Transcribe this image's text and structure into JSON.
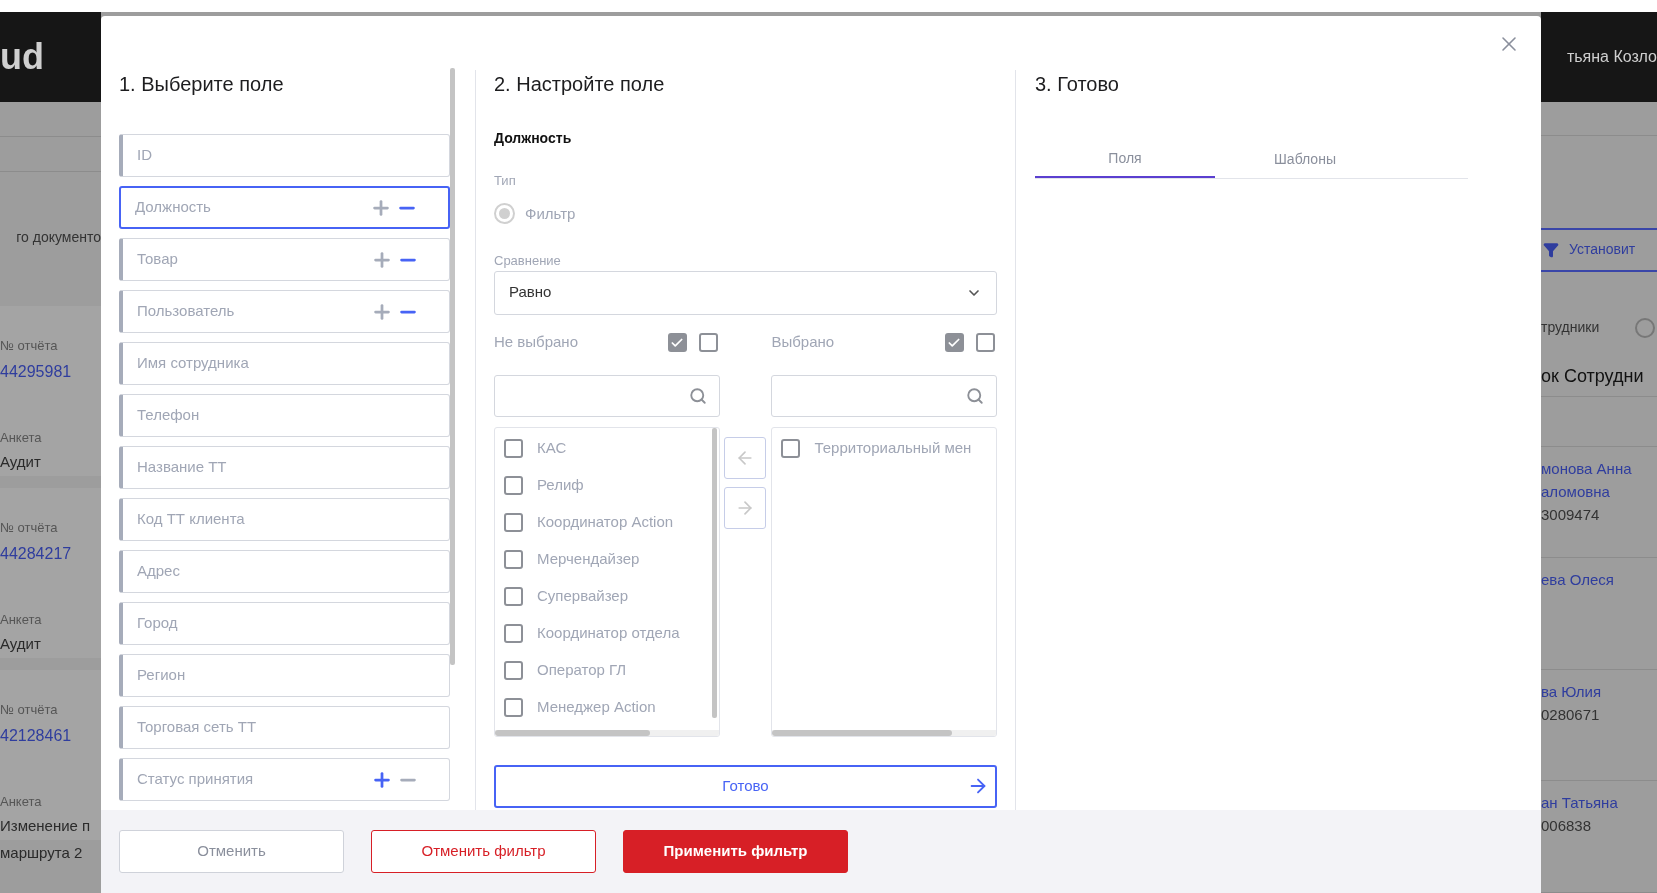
{
  "background": {
    "logo": "ud",
    "user_name": "тьяна Козло",
    "document_label": "го документо",
    "reports": [
      {
        "number_label": "№ отчёта",
        "number": "44295981",
        "form_label": "Анкета",
        "form_lines": [
          "Аудит"
        ]
      },
      {
        "number_label": "№ отчёта",
        "number": "44284217",
        "form_label": "Анкета",
        "form_lines": [
          "Аудит"
        ]
      },
      {
        "number_label": "№ отчёта",
        "number": "42128461",
        "form_label": "Анкета",
        "form_lines": [
          "Изменение п",
          "маршрута 2"
        ]
      }
    ],
    "filter_button": "Установит",
    "employees_label": "трудники",
    "list_title": "ок Сотрудни",
    "employees": [
      {
        "name_lines": [
          "монова Анна",
          "аломовна"
        ],
        "id": "3009474"
      },
      {
        "name_lines": [
          "ева Олеся"
        ]
      },
      {
        "name_lines": [
          "ва Юлия"
        ],
        "id": "0280671"
      },
      {
        "name_lines": [
          "ан Татьяна"
        ],
        "id": "006838"
      }
    ]
  },
  "dialog": {
    "step1": {
      "title": "1. Выберите поле",
      "fields": [
        {
          "label": "ID",
          "kind": "plain",
          "selected": false
        },
        {
          "label": "Должность",
          "kind": "toggle",
          "selected": true,
          "plus_active": false,
          "minus_active": true
        },
        {
          "label": "Товар",
          "kind": "toggle",
          "selected": false,
          "plus_active": false,
          "minus_active": true
        },
        {
          "label": "Пользователь",
          "kind": "toggle",
          "selected": false,
          "plus_active": false,
          "minus_active": true
        },
        {
          "label": "Имя сотрудника",
          "kind": "plain",
          "selected": false
        },
        {
          "label": "Телефон",
          "kind": "plain",
          "selected": false
        },
        {
          "label": "Название ТТ",
          "kind": "plain",
          "selected": false
        },
        {
          "label": "Код ТТ клиента",
          "kind": "plain",
          "selected": false
        },
        {
          "label": "Адрес",
          "kind": "plain",
          "selected": false
        },
        {
          "label": "Город",
          "kind": "plain",
          "selected": false
        },
        {
          "label": "Регион",
          "kind": "plain",
          "selected": false
        },
        {
          "label": "Торговая сеть ТТ",
          "kind": "plain",
          "selected": false
        },
        {
          "label": "Статус принятия",
          "kind": "toggle",
          "selected": false,
          "plus_active": true,
          "minus_active": false
        }
      ]
    },
    "step2": {
      "title": "2. Настройте поле",
      "field_name": "Должность",
      "type_label": "Тип",
      "type_option": {
        "label": "Фильтр",
        "selected": true
      },
      "comparison": {
        "label": "Сравнение",
        "value": "Равно"
      },
      "lists": [
        {
          "title": "Не выбрано",
          "header_checkboxes": [
            {
              "checked": true
            },
            {
              "checked": false
            }
          ],
          "items": [
            {
              "label": "КАС",
              "checked": false
            },
            {
              "label": "Релиф",
              "checked": false
            },
            {
              "label": "Координатор Action",
              "checked": false
            },
            {
              "label": "Мерчендайзер",
              "checked": false
            },
            {
              "label": "Супервайзер",
              "checked": false
            },
            {
              "label": "Координатор отдела",
              "checked": false
            },
            {
              "label": "Оператор ГЛ",
              "checked": false
            },
            {
              "label": "Менеджер Action",
              "checked": false
            }
          ]
        },
        {
          "title": "Выбрано",
          "header_checkboxes": [
            {
              "checked": true
            },
            {
              "checked": false
            }
          ],
          "items": [
            {
              "label": "Территориальный мен",
              "checked": false
            }
          ]
        }
      ],
      "done_button": "Готово"
    },
    "step3": {
      "title": "3. Готово",
      "tabs": [
        {
          "label": "Поля",
          "selected": true
        },
        {
          "label": "Шаблоны",
          "selected": false
        }
      ]
    },
    "footer": {
      "buttons": [
        {
          "label": "Отменить",
          "kind": "secondary"
        },
        {
          "label": "Отменить фильтр",
          "kind": "outline-danger"
        },
        {
          "label": "Применить фильтр",
          "kind": "danger"
        }
      ]
    }
  }
}
